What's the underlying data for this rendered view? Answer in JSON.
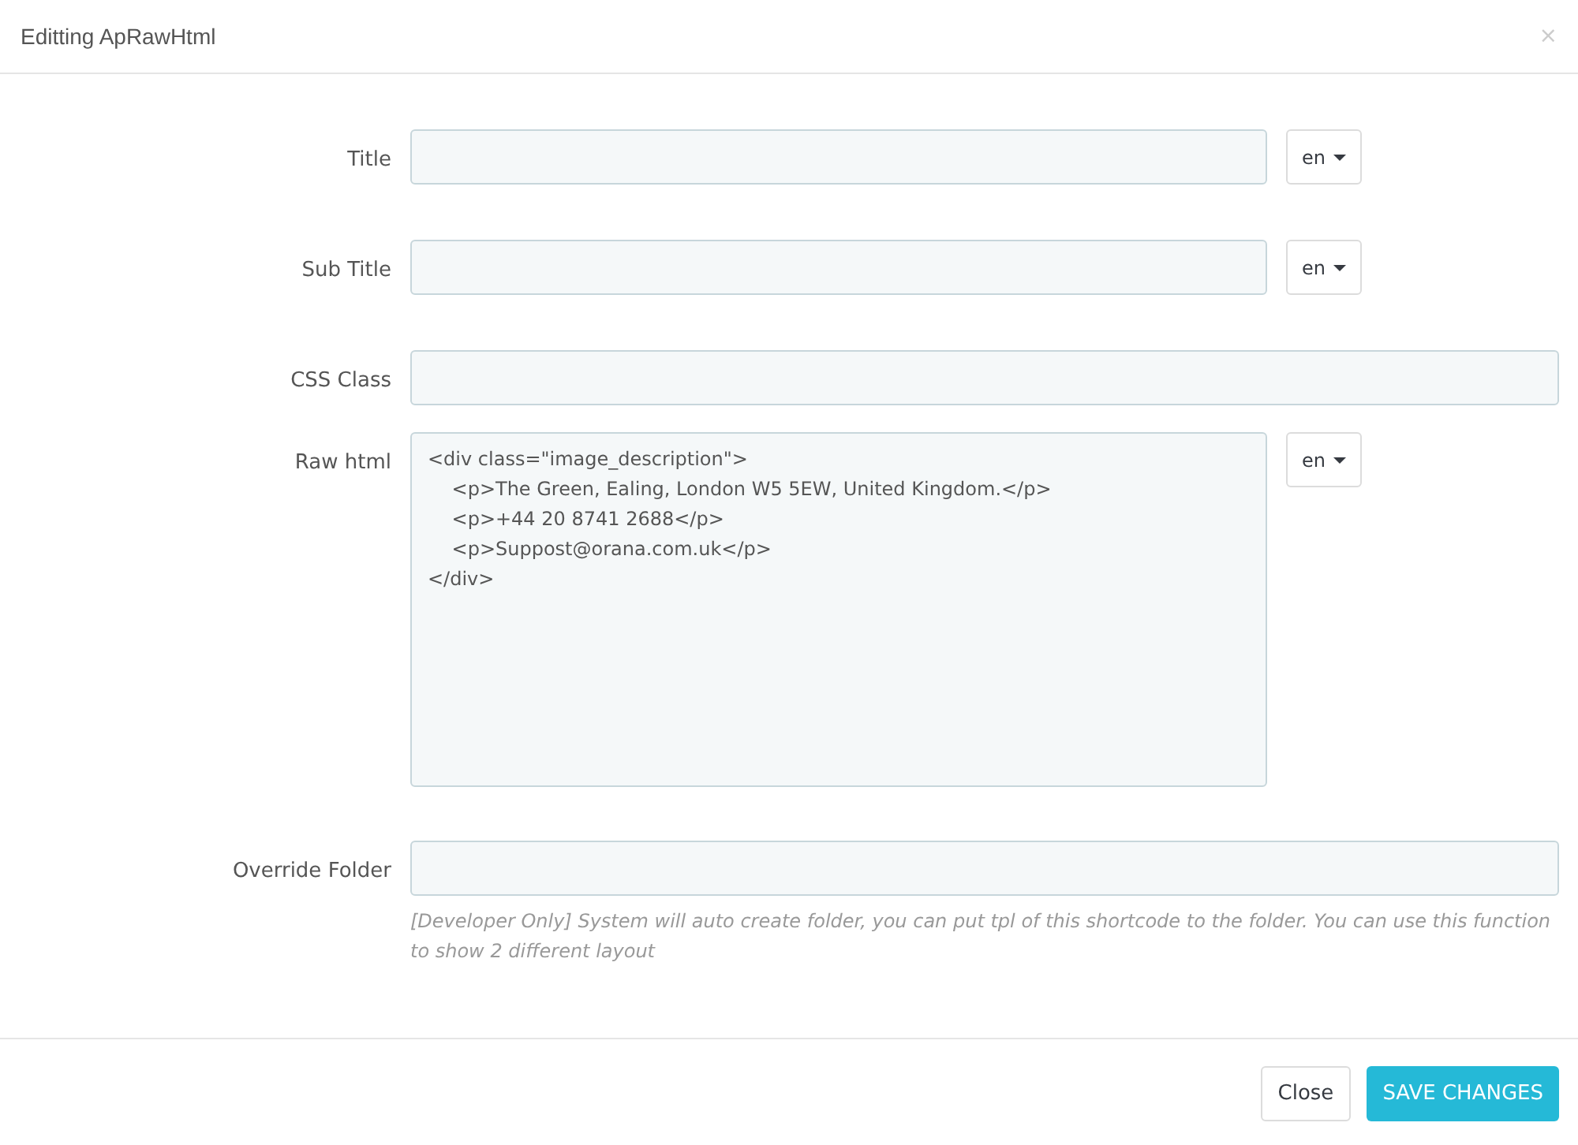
{
  "dialog": {
    "title": "Editting ApRawHtml",
    "close": "×"
  },
  "fields": [
    {
      "kind": "text",
      "label": "Title",
      "language": "en"
    },
    {
      "kind": "text",
      "label": "Sub Title",
      "language": "en"
    },
    {
      "kind": "text",
      "label": "CSS Class"
    },
    {
      "kind": "textarea",
      "label": "Raw html",
      "value": "<div class=\"image_description\">\n    <p>The Green, Ealing, London W5 5EW, United Kingdom.</p>\n    <p>+44 20 8741 2688</p>\n    <p>Suppost@orana.com.uk</p>\n</div>",
      "language": "en"
    },
    {
      "kind": "text",
      "label": "Override Folder",
      "help": "[Developer Only] System will auto create folder, you can put tpl of this shortcode to the folder. You can use this function to show 2 different layout"
    }
  ],
  "buttons": [
    {
      "label": "Close",
      "kind": "default"
    },
    {
      "label": "SAVE CHANGES",
      "kind": "primary"
    }
  ]
}
